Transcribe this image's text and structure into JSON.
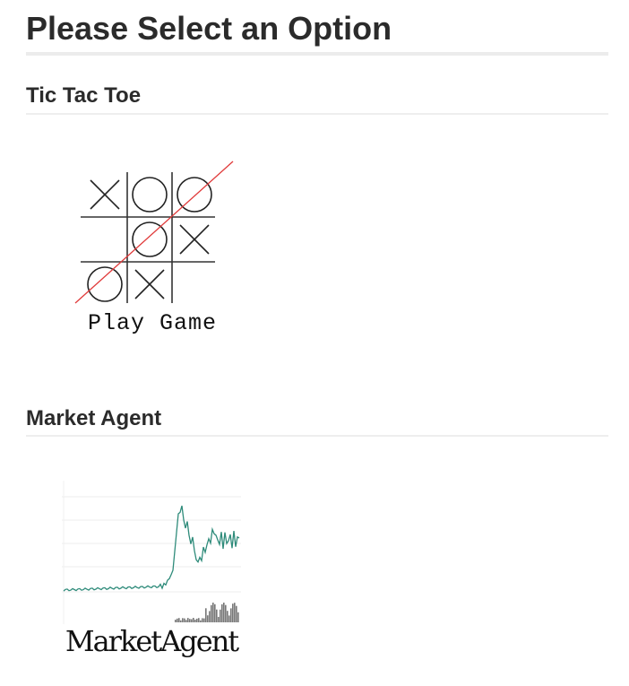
{
  "page": {
    "title": "Please Select an Option"
  },
  "sections": [
    {
      "title": "Tic Tac Toe",
      "tile": {
        "caption": "Play Game",
        "icon": "tic-tac-toe-board-icon",
        "board": [
          [
            "X",
            "O",
            "O"
          ],
          [
            "",
            "O",
            "X"
          ],
          [
            "O",
            "X",
            ""
          ]
        ],
        "winning_line_color": "#e03a3a"
      }
    },
    {
      "title": "Market Agent",
      "tile": {
        "caption": "MarketAgent",
        "icon": "price-chart-icon",
        "line_color": "#2e8b7a",
        "volume_color": "#777777"
      }
    }
  ]
}
